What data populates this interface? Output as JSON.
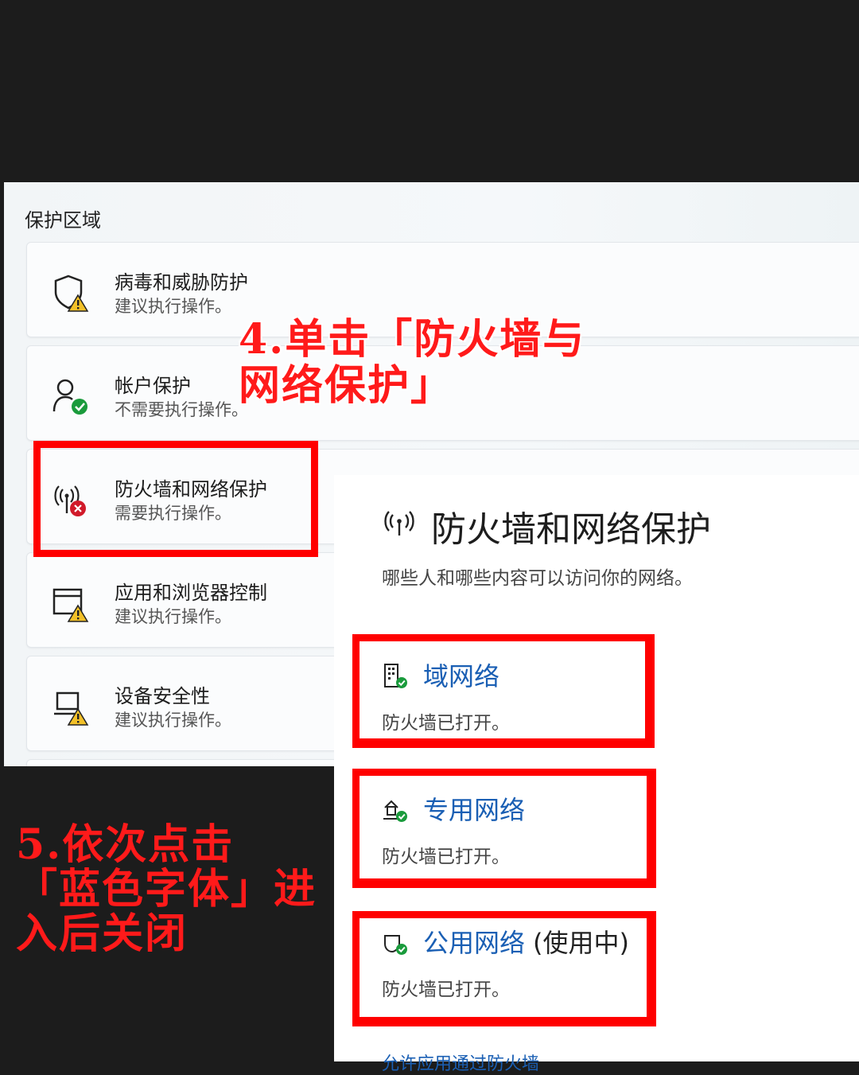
{
  "protection": {
    "section_title": "保护区域",
    "cards": [
      {
        "title": "病毒和威胁防护",
        "status": "建议执行操作。",
        "icon": "shield-warning-icon"
      },
      {
        "title": "帐户保护",
        "status": "不需要执行操作。",
        "icon": "account-ok-icon"
      },
      {
        "title": "防火墙和网络保护",
        "status": "需要执行操作。",
        "icon": "wifi-error-icon"
      },
      {
        "title": "应用和浏览器控制",
        "status": "建议执行操作。",
        "icon": "browser-warning-icon"
      },
      {
        "title": "设备安全性",
        "status": "建议执行操作。",
        "icon": "device-warning-icon"
      }
    ]
  },
  "firewall": {
    "title": "防火墙和网络保护",
    "description": "哪些人和哪些内容可以访问你的网络。",
    "networks": [
      {
        "name": "域网络",
        "tag": "",
        "status": "防火墙已打开。",
        "icon": "domain-network-icon"
      },
      {
        "name": "专用网络",
        "tag": "",
        "status": "防火墙已打开。",
        "icon": "private-network-icon"
      },
      {
        "name": "公用网络",
        "tag": "(使用中)",
        "status": "防火墙已打开。",
        "icon": "public-network-icon"
      }
    ],
    "cutoff_link": "允许应用通过防火墙"
  },
  "annotations": {
    "step4": "4.单击「防火墙与网络保护」",
    "step5": "5.依次点击「蓝色字体」进入后关闭"
  },
  "colors": {
    "highlight": "#ff0000",
    "link": "#1a5fb4",
    "warning": "#f2c028",
    "ok": "#1a9b3c",
    "error": "#d11a2a"
  }
}
